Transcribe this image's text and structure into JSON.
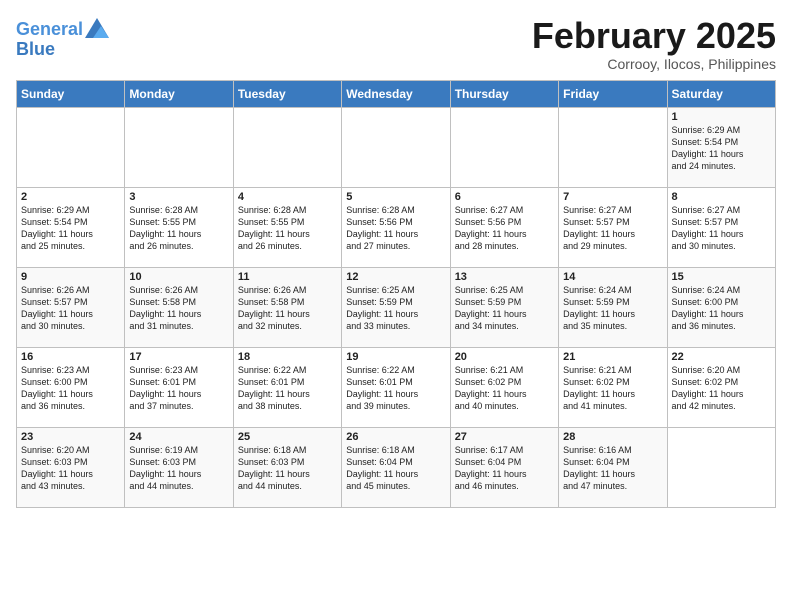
{
  "logo": {
    "line1": "General",
    "line2": "Blue"
  },
  "title": "February 2025",
  "subtitle": "Corrooy, Ilocos, Philippines",
  "days_of_week": [
    "Sunday",
    "Monday",
    "Tuesday",
    "Wednesday",
    "Thursday",
    "Friday",
    "Saturday"
  ],
  "weeks": [
    [
      {
        "day": "",
        "text": ""
      },
      {
        "day": "",
        "text": ""
      },
      {
        "day": "",
        "text": ""
      },
      {
        "day": "",
        "text": ""
      },
      {
        "day": "",
        "text": ""
      },
      {
        "day": "",
        "text": ""
      },
      {
        "day": "1",
        "text": "Sunrise: 6:29 AM\nSunset: 5:54 PM\nDaylight: 11 hours\nand 24 minutes."
      }
    ],
    [
      {
        "day": "2",
        "text": "Sunrise: 6:29 AM\nSunset: 5:54 PM\nDaylight: 11 hours\nand 25 minutes."
      },
      {
        "day": "3",
        "text": "Sunrise: 6:28 AM\nSunset: 5:55 PM\nDaylight: 11 hours\nand 26 minutes."
      },
      {
        "day": "4",
        "text": "Sunrise: 6:28 AM\nSunset: 5:55 PM\nDaylight: 11 hours\nand 26 minutes."
      },
      {
        "day": "5",
        "text": "Sunrise: 6:28 AM\nSunset: 5:56 PM\nDaylight: 11 hours\nand 27 minutes."
      },
      {
        "day": "6",
        "text": "Sunrise: 6:27 AM\nSunset: 5:56 PM\nDaylight: 11 hours\nand 28 minutes."
      },
      {
        "day": "7",
        "text": "Sunrise: 6:27 AM\nSunset: 5:57 PM\nDaylight: 11 hours\nand 29 minutes."
      },
      {
        "day": "8",
        "text": "Sunrise: 6:27 AM\nSunset: 5:57 PM\nDaylight: 11 hours\nand 30 minutes."
      }
    ],
    [
      {
        "day": "9",
        "text": "Sunrise: 6:26 AM\nSunset: 5:57 PM\nDaylight: 11 hours\nand 30 minutes."
      },
      {
        "day": "10",
        "text": "Sunrise: 6:26 AM\nSunset: 5:58 PM\nDaylight: 11 hours\nand 31 minutes."
      },
      {
        "day": "11",
        "text": "Sunrise: 6:26 AM\nSunset: 5:58 PM\nDaylight: 11 hours\nand 32 minutes."
      },
      {
        "day": "12",
        "text": "Sunrise: 6:25 AM\nSunset: 5:59 PM\nDaylight: 11 hours\nand 33 minutes."
      },
      {
        "day": "13",
        "text": "Sunrise: 6:25 AM\nSunset: 5:59 PM\nDaylight: 11 hours\nand 34 minutes."
      },
      {
        "day": "14",
        "text": "Sunrise: 6:24 AM\nSunset: 5:59 PM\nDaylight: 11 hours\nand 35 minutes."
      },
      {
        "day": "15",
        "text": "Sunrise: 6:24 AM\nSunset: 6:00 PM\nDaylight: 11 hours\nand 36 minutes."
      }
    ],
    [
      {
        "day": "16",
        "text": "Sunrise: 6:23 AM\nSunset: 6:00 PM\nDaylight: 11 hours\nand 36 minutes."
      },
      {
        "day": "17",
        "text": "Sunrise: 6:23 AM\nSunset: 6:01 PM\nDaylight: 11 hours\nand 37 minutes."
      },
      {
        "day": "18",
        "text": "Sunrise: 6:22 AM\nSunset: 6:01 PM\nDaylight: 11 hours\nand 38 minutes."
      },
      {
        "day": "19",
        "text": "Sunrise: 6:22 AM\nSunset: 6:01 PM\nDaylight: 11 hours\nand 39 minutes."
      },
      {
        "day": "20",
        "text": "Sunrise: 6:21 AM\nSunset: 6:02 PM\nDaylight: 11 hours\nand 40 minutes."
      },
      {
        "day": "21",
        "text": "Sunrise: 6:21 AM\nSunset: 6:02 PM\nDaylight: 11 hours\nand 41 minutes."
      },
      {
        "day": "22",
        "text": "Sunrise: 6:20 AM\nSunset: 6:02 PM\nDaylight: 11 hours\nand 42 minutes."
      }
    ],
    [
      {
        "day": "23",
        "text": "Sunrise: 6:20 AM\nSunset: 6:03 PM\nDaylight: 11 hours\nand 43 minutes."
      },
      {
        "day": "24",
        "text": "Sunrise: 6:19 AM\nSunset: 6:03 PM\nDaylight: 11 hours\nand 44 minutes."
      },
      {
        "day": "25",
        "text": "Sunrise: 6:18 AM\nSunset: 6:03 PM\nDaylight: 11 hours\nand 44 minutes."
      },
      {
        "day": "26",
        "text": "Sunrise: 6:18 AM\nSunset: 6:04 PM\nDaylight: 11 hours\nand 45 minutes."
      },
      {
        "day": "27",
        "text": "Sunrise: 6:17 AM\nSunset: 6:04 PM\nDaylight: 11 hours\nand 46 minutes."
      },
      {
        "day": "28",
        "text": "Sunrise: 6:16 AM\nSunset: 6:04 PM\nDaylight: 11 hours\nand 47 minutes."
      },
      {
        "day": "",
        "text": ""
      }
    ]
  ]
}
